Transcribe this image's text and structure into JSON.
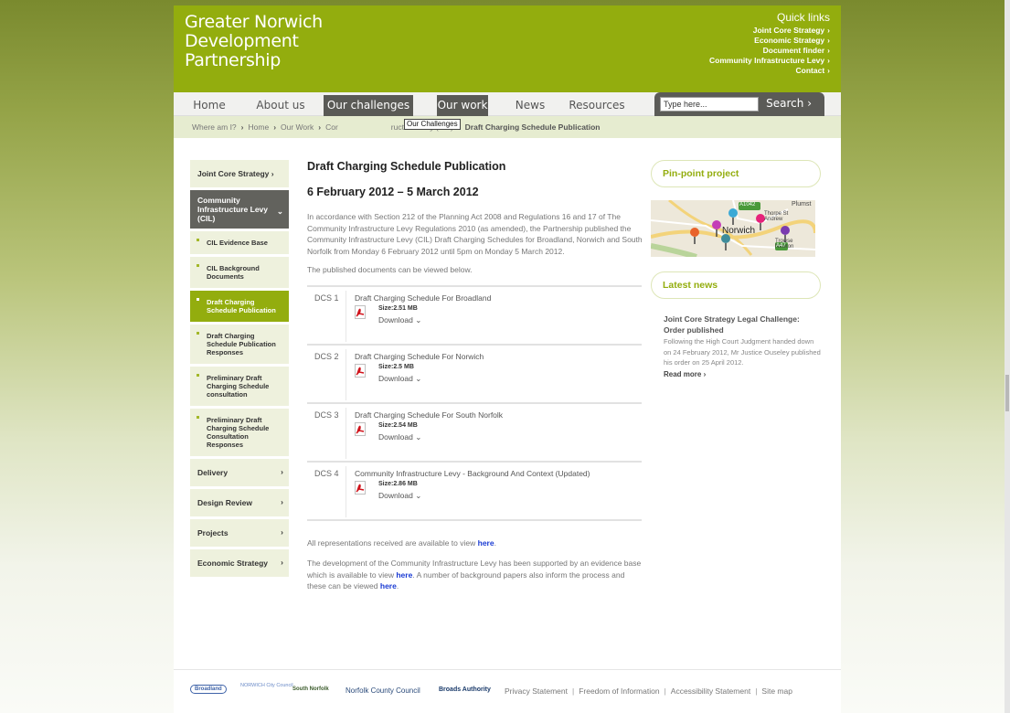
{
  "header": {
    "logo_line1": "Greater Norwich",
    "logo_line2": "Development",
    "logo_line3": "Partnership",
    "quick_links_title": "Quick links",
    "quick_links": [
      "Joint Core Strategy",
      "Economic Strategy",
      "Document finder",
      "Community Infrastructure Levy",
      "Contact"
    ]
  },
  "nav": {
    "items": [
      "Home",
      "About us",
      "Our challenges",
      "Our work",
      "News",
      "Resources"
    ],
    "search_value": "Type here...",
    "search_button": "Search"
  },
  "breadcrumb": {
    "label": "Where am I?",
    "items": [
      "Home",
      "Our Work",
      "Cor",
      "ructure Levy (CIL)"
    ],
    "current": "Draft Charging Schedule Publication",
    "tooltip": "Our Challenges"
  },
  "sidebar": {
    "jcs": "Joint Core Strategy",
    "cil": "Community Infrastructure Levy (CIL)",
    "subs": [
      "CIL Evidence Base",
      "CIL Background Documents",
      "Draft Charging Schedule Publication",
      "Draft Charging Schedule Publication Responses",
      "Preliminary Draft Charging Schedule consultation",
      "Preliminary Draft Charging Schedule Consultation Responses"
    ],
    "bottom": [
      "Delivery",
      "Design Review",
      "Projects",
      "Economic Strategy"
    ]
  },
  "main": {
    "title": "Draft Charging Schedule Publication",
    "dates": "6 February 2012 – 5 March 2012",
    "intro": "In accordance with Section 212 of the Planning Act 2008 and Regulations 16 and 17 of The Community Infrastructure Levy Regulations 2010 (as amended), the Partnership published the Community Infrastructure Levy (CIL) Draft Charging Schedules for Broadland, Norwich and South Norfolk from Monday 6 February 2012 until 5pm on Monday 5 March 2012.",
    "published_view": "The published documents can be viewed below.",
    "download_label": "Download",
    "docs": [
      {
        "code": "DCS 1",
        "title": "Draft Charging Schedule For Broadland",
        "size": "Size:2.51 MB"
      },
      {
        "code": "DCS 2",
        "title": "Draft Charging Schedule For Norwich",
        "size": "Size:2.5 MB"
      },
      {
        "code": "DCS 3",
        "title": "Draft Charging Schedule For South Norfolk",
        "size": "Size:2.54 MB"
      },
      {
        "code": "DCS 4",
        "title": "Community Infrastructure Levy - Background And Context (Updated)",
        "size": "Size:2.86 MB"
      }
    ],
    "reps_text": "All representations received are available to view",
    "here": "here",
    "dev_text1": "The development of the Community Infrastructure Levy has been supported by an evidence base which is available to view",
    "dev_text2": ". A number of background papers also inform the process and these can be viewed",
    "period": "."
  },
  "right": {
    "pinpoint": "Pin-point project",
    "map_labels": [
      "Norwich",
      "Thorpe St Andrew",
      "Trowse Newton",
      "Plumst",
      "A1042",
      "A47"
    ],
    "latest_news": "Latest news",
    "news_title": "Joint Core Strategy Legal Challenge: Order published",
    "news_body": "Following the High Court Judgment handed down on 24 February 2012, Mr Justice Ouseley published his order on 25 April 2012.",
    "read_more": "Read more"
  },
  "footer": {
    "logos": [
      "Broadland",
      "NORWICH City Council",
      "South Norfolk",
      "Norfolk County Council",
      "Broads Authority"
    ],
    "links": [
      "Privacy Statement",
      "Freedom of Information",
      "Accessibility Statement",
      "Site map"
    ]
  }
}
